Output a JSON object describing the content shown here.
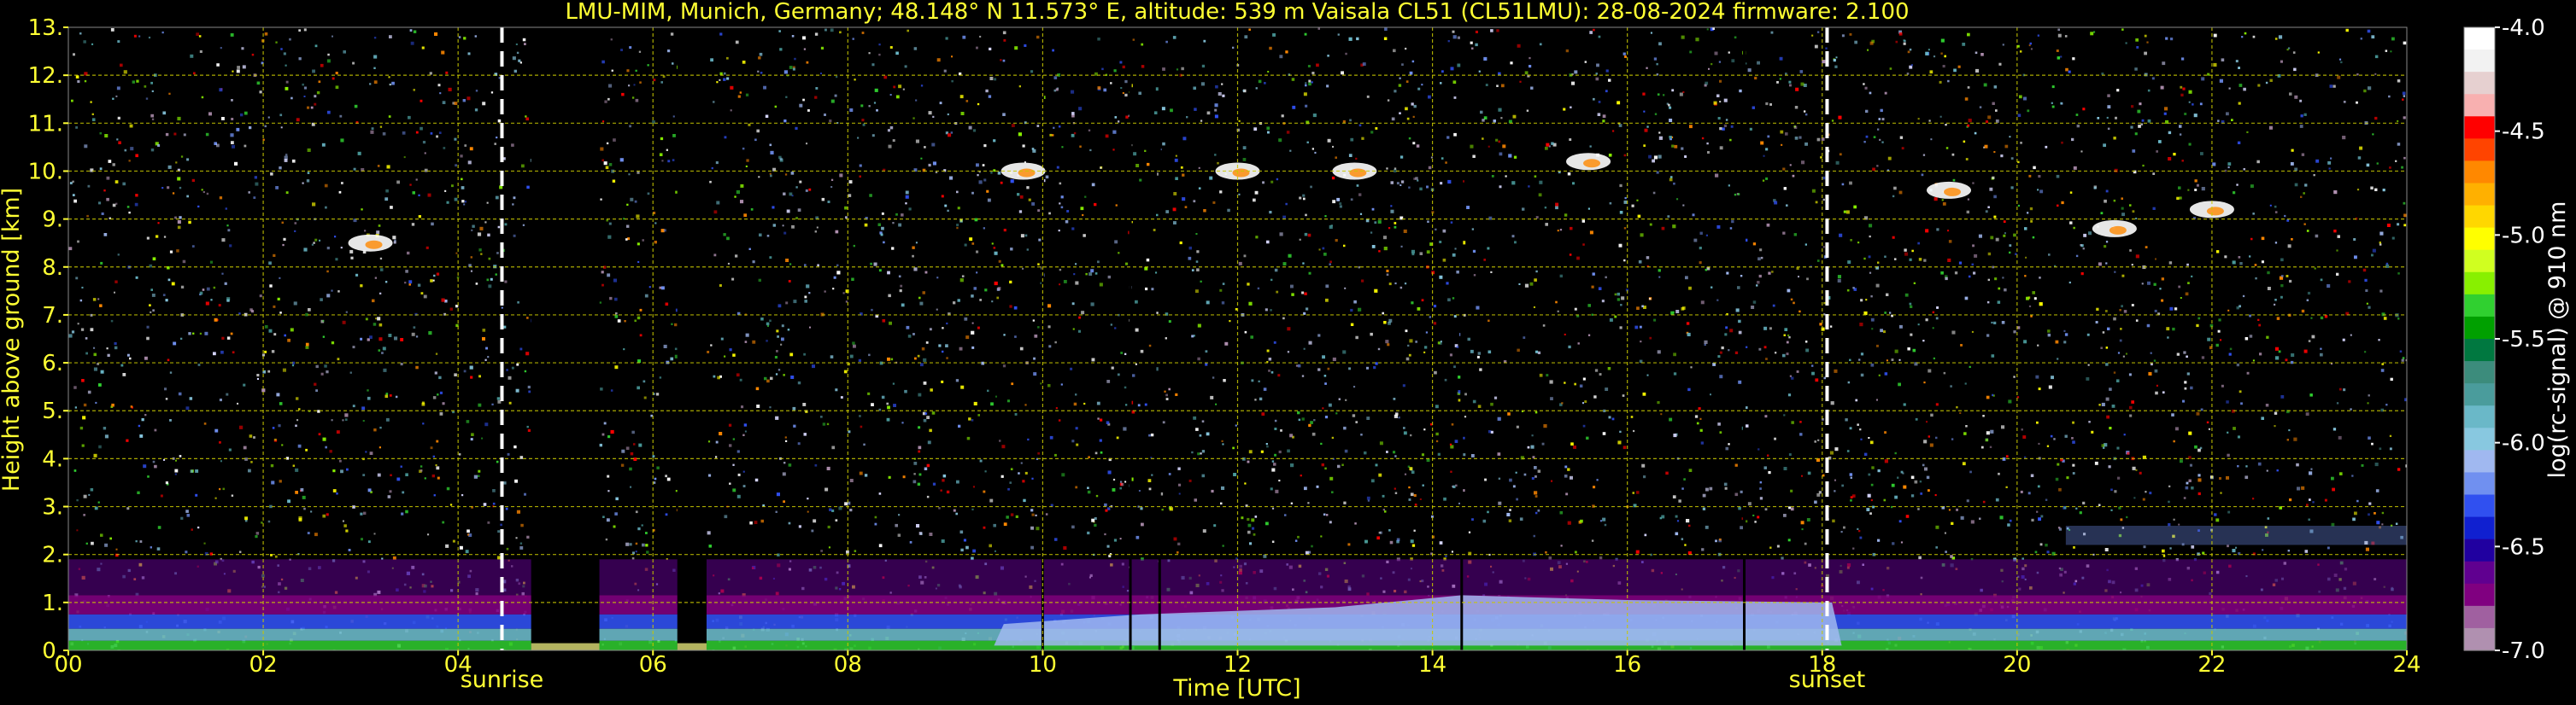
{
  "chart_data": {
    "type": "heatmap",
    "title": "LMU-MIM, Munich, Germany; 48.148° N 11.573° E, altitude: 539 m    Vaisala CL51 (CL51LMU): 28-08-2024    firmware: 2.100",
    "xlabel": "Time [UTC]",
    "ylabel": "Height above ground [km]",
    "xlim": [
      0,
      24
    ],
    "ylim": [
      0,
      13
    ],
    "x_ticks": [
      "00",
      "02",
      "04",
      "06",
      "08",
      "10",
      "12",
      "14",
      "16",
      "18",
      "20",
      "22",
      "24"
    ],
    "x_tick_values": [
      0,
      2,
      4,
      6,
      8,
      10,
      12,
      14,
      16,
      18,
      20,
      22,
      24
    ],
    "y_ticks": [
      "0.",
      "1.",
      "2.",
      "3.",
      "4.",
      "5.",
      "6.",
      "7.",
      "8.",
      "9.",
      "10.",
      "11.",
      "12.",
      "13."
    ],
    "y_tick_values": [
      0,
      1,
      2,
      3,
      4,
      5,
      6,
      7,
      8,
      9,
      10,
      11,
      12,
      13
    ],
    "grid": true,
    "annotations": [
      {
        "label": "sunrise",
        "x": 4.45
      },
      {
        "label": "sunset",
        "x": 18.05
      }
    ],
    "colorbar": {
      "label": "log(rc-signal) @ 910 nm",
      "range": [
        -7.0,
        -4.0
      ],
      "ticks": [
        "-4.0",
        "-4.5",
        "-5.0",
        "-5.5",
        "-6.0",
        "-6.5",
        "-7.0"
      ],
      "tick_values": [
        -4.0,
        -4.5,
        -5.0,
        -5.5,
        -6.0,
        -6.5,
        -7.0
      ],
      "colors": [
        "#ffffff",
        "#f2f2f2",
        "#e6d0d0",
        "#f8b0b0",
        "#ff0000",
        "#ff4400",
        "#ff8800",
        "#ffb000",
        "#ffd700",
        "#ffff00",
        "#d0ff20",
        "#88f000",
        "#30d030",
        "#00a000",
        "#007840",
        "#3c8c7c",
        "#4a9c9c",
        "#6ab8c8",
        "#88c8e0",
        "#a0b8f0",
        "#7090f0",
        "#3050f0",
        "#1020d0",
        "#2000a0",
        "#600090",
        "#800080",
        "#a060a0",
        "#b090b0"
      ]
    },
    "features": [
      {
        "type": "data_gap",
        "x": [
          4.75,
          5.45
        ]
      },
      {
        "type": "data_gap",
        "x": [
          6.25,
          6.55
        ]
      },
      {
        "type": "cloud",
        "x": 3.1,
        "height_km": 8.5
      },
      {
        "type": "cloud",
        "x": 9.8,
        "height_km": 10.0
      },
      {
        "type": "cloud",
        "x": 12.0,
        "height_km": 10.0
      },
      {
        "type": "cloud",
        "x": 13.2,
        "height_km": 10.0
      },
      {
        "type": "cloud",
        "x": 15.6,
        "height_km": 10.2
      },
      {
        "type": "cloud",
        "x": 19.3,
        "height_km": 9.6
      },
      {
        "type": "cloud",
        "x": 21.0,
        "height_km": 8.8
      },
      {
        "type": "cloud",
        "x": 22.0,
        "height_km": 9.2
      },
      {
        "type": "boundary_layer_top",
        "height_km": 1.0
      }
    ],
    "colors": {
      "text": "#ffff33",
      "grid": "#c8c800",
      "background": "#000000",
      "marker_line": "#ffffff"
    }
  }
}
